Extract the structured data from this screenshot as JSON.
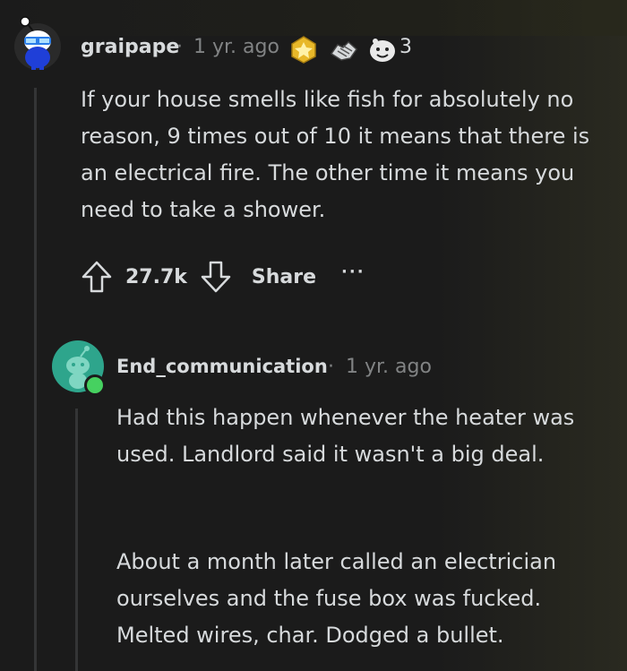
{
  "comment1": {
    "username": "graipape",
    "separator": "·",
    "time": "1 yr. ago",
    "award_count": "3",
    "body": "If your house smells like fish for absolutely no reason, 9 times out of 10 it means that there is an electrical fire. The other time it means you need to take a shower.",
    "score": "27.7k",
    "share_label": "Share",
    "more_label": "···"
  },
  "comment2": {
    "username": "End_communication",
    "separator": "·",
    "time": "1 yr. ago",
    "paragraph1": "Had this happen whenever the heater was used. Landlord said it wasn't a big deal.",
    "paragraph2": "About a month later called an electrician ourselves and the fuse box was fucked. Melted wires, char. Dodged a bullet."
  },
  "colors": {
    "background": "#1a1a1b",
    "text": "#d7dadc",
    "meta": "#818384",
    "online_dot": "#46d160",
    "avatar2_bg": "#2ea58c"
  },
  "icons": [
    "snoo-avatar-icon",
    "gold-award-icon",
    "handshake-award-icon",
    "wholesome-award-icon",
    "upvote-icon",
    "downvote-icon",
    "snoo-avatar-icon"
  ]
}
